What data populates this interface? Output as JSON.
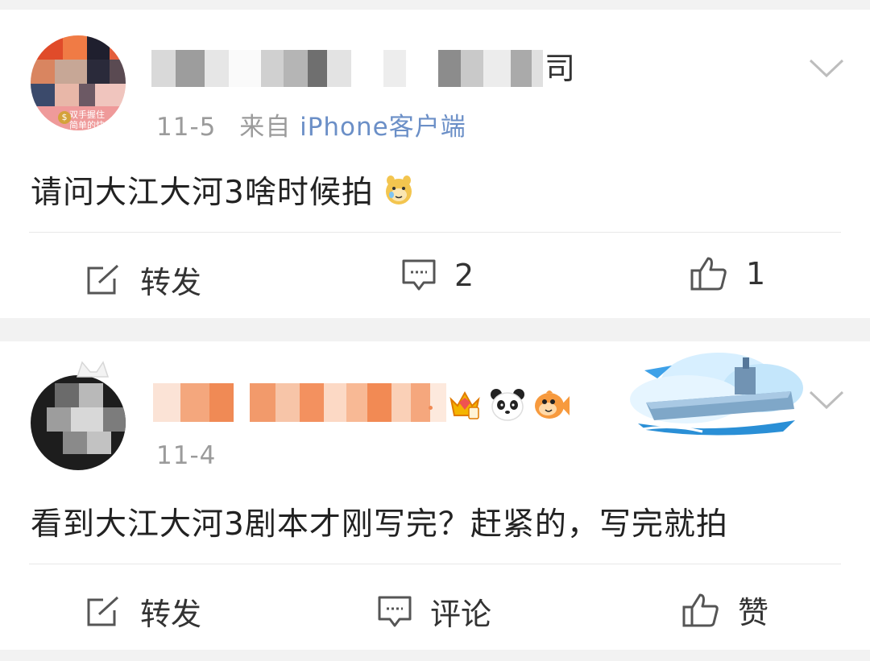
{
  "posts": [
    {
      "author_suffix": "司",
      "avatar_caption_line1": "双手握住",
      "avatar_caption_line2": "简单的快",
      "date": "11-5",
      "source_prefix": "来自",
      "source": "iPhone客户端",
      "content": "请问大江大河3啥时候拍",
      "actions": {
        "repost": "转发",
        "comment": "2",
        "like": "1"
      }
    },
    {
      "date": "11-4",
      "content": "看到大江大河3剧本才刚写完？赶紧的，写完就拍",
      "actions": {
        "repost": "转发",
        "comment": "评论",
        "like": "赞"
      }
    }
  ],
  "icons": [
    "edit-share-icon",
    "comment-bubble-icon",
    "thumbs-up-icon",
    "chevron-down-icon",
    "emoji-icon",
    "crown-badge-icon",
    "panda-icon",
    "fish-icon"
  ]
}
